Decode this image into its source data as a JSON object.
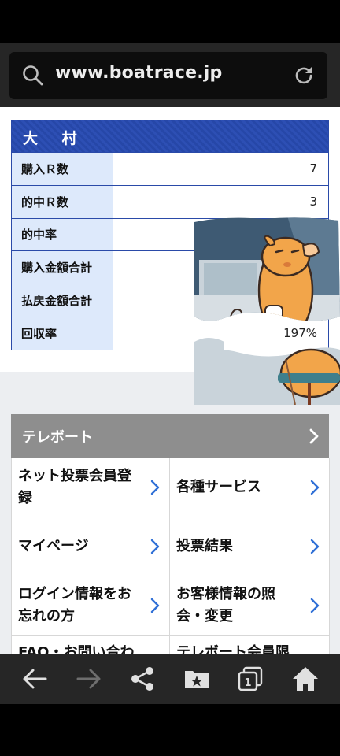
{
  "browser": {
    "url": "www.boatrace.jp"
  },
  "stats": {
    "title": "大 村",
    "rows": [
      {
        "label": "購入Ｒ数",
        "value": "7"
      },
      {
        "label": "的中Ｒ数",
        "value": "3"
      },
      {
        "label": "的中率",
        "value": ""
      },
      {
        "label": "購入金額合計",
        "value": ""
      },
      {
        "label": "払戻金額合計",
        "value": ""
      },
      {
        "label": "回収率",
        "value": "197%"
      }
    ]
  },
  "teleboat": {
    "title": "テレボート",
    "items": [
      {
        "label": "ネット投票会員登録"
      },
      {
        "label": "各種サービス"
      },
      {
        "label": "マイページ"
      },
      {
        "label": "投票結果"
      },
      {
        "label": "ログイン情報をお忘れの方"
      },
      {
        "label": "お客様情報の照会・変更"
      },
      {
        "label": "FAQ・お問い合わ"
      },
      {
        "label": "テレボート会員限"
      }
    ]
  },
  "colors": {
    "accent_blue": "#2a4aa8",
    "label_bg": "#dde9fb",
    "chevron_blue": "#2f6fd6",
    "mascot_orange": "#f2a54a"
  },
  "icons": {
    "search": "search-icon",
    "reload": "reload-icon",
    "back": "back-arrow-icon",
    "forward": "forward-arrow-icon",
    "share": "share-icon",
    "bookmark": "bookmark-star-icon",
    "tabs": "tabs-icon",
    "home": "home-icon"
  },
  "bottom_nav": {
    "tab_count": "1"
  }
}
